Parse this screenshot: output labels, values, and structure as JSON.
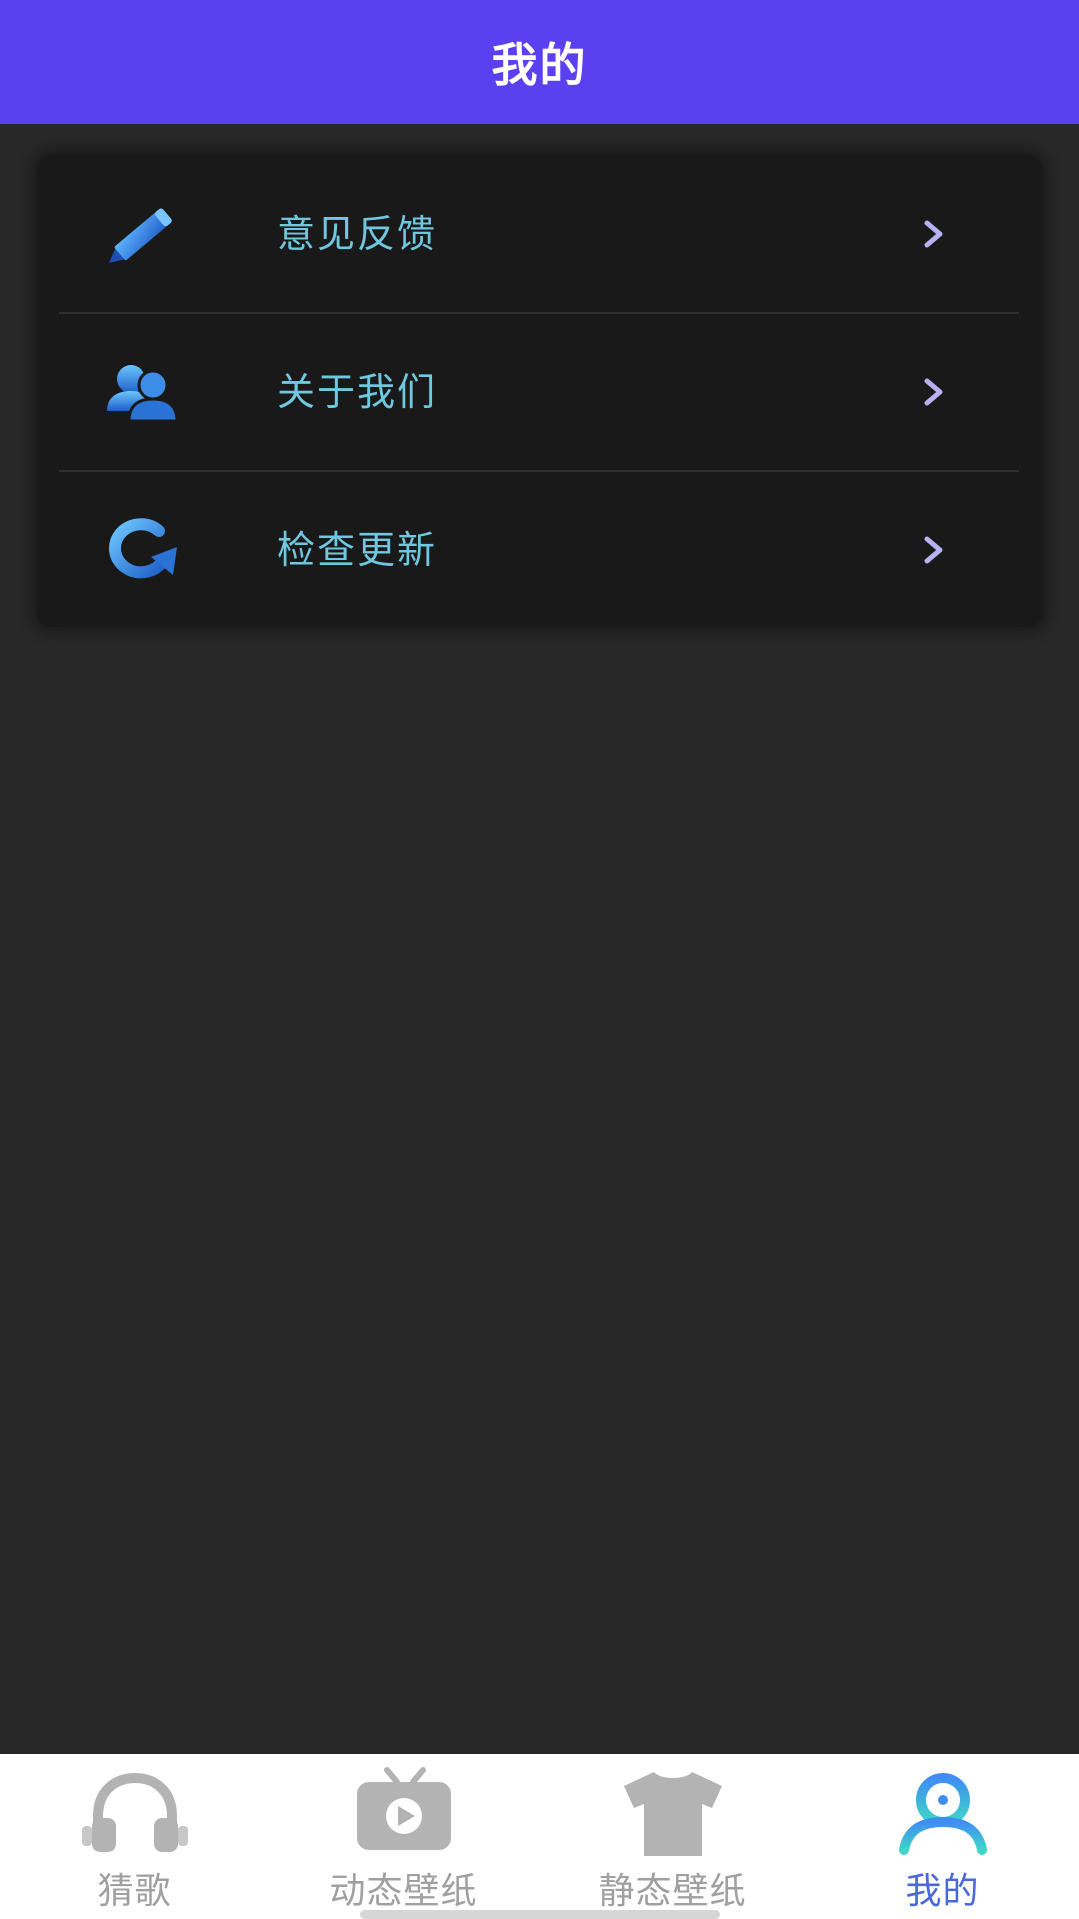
{
  "header": {
    "title": "我的"
  },
  "menu": {
    "items": [
      {
        "label": "意见反馈",
        "icon": "pencil-icon"
      },
      {
        "label": "关于我们",
        "icon": "users-icon"
      },
      {
        "label": "检查更新",
        "icon": "refresh-icon"
      }
    ]
  },
  "tabbar": {
    "tabs": [
      {
        "label": "猜歌",
        "icon": "headphones-icon",
        "active": false
      },
      {
        "label": "动态壁纸",
        "icon": "tv-play-icon",
        "active": false
      },
      {
        "label": "静态壁纸",
        "icon": "tshirt-icon",
        "active": false
      },
      {
        "label": "我的",
        "icon": "person-icon",
        "active": true
      }
    ]
  },
  "colors": {
    "header_bg": "#5b40ef",
    "page_bg": "#282828",
    "card_bg": "#191919",
    "menu_label": "#6fc8e0",
    "chevron": "#b8b0f0",
    "tab_inactive": "#a0a0a0",
    "tab_active": "#4a68d8"
  }
}
